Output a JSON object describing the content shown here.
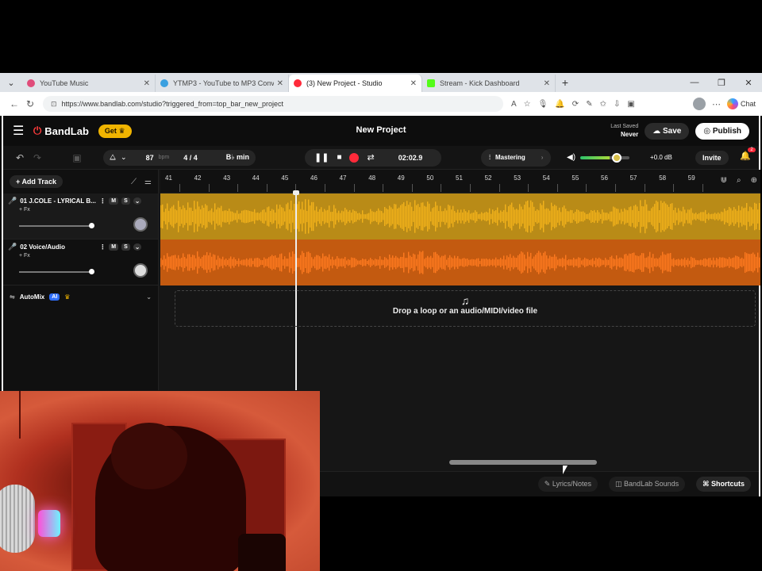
{
  "browser": {
    "tabs": [
      {
        "title": "YouTube Music",
        "favicon_color": "#e04c7a"
      },
      {
        "title": "YTMP3 - YouTube to MP3 Convert",
        "favicon_color": "#3aa0e0"
      },
      {
        "title": "(3) New Project - Studio",
        "favicon_color": "#ff2a3a"
      },
      {
        "title": "Stream - Kick Dashboard",
        "favicon_color": "#53fc18"
      }
    ],
    "url": "https://www.bandlab.com/studio?triggered_from=top_bar_new_project",
    "chat_label": "Chat"
  },
  "app": {
    "brand": "BandLab",
    "get_label": "Get",
    "project_title": "New Project",
    "last_saved_label": "Last Saved",
    "last_saved_value": "Never",
    "save_label": "Save",
    "publish_label": "Publish"
  },
  "toolbar": {
    "bpm_value": "87",
    "bpm_unit": "bpm",
    "time_signature": "4 / 4",
    "key": "B♭ min",
    "time": "02:02.9",
    "mastering_label": "Mastering",
    "volume_db": "+0.0 dB",
    "invite_label": "Invite",
    "notifications": "2"
  },
  "left_panel": {
    "add_track_label": "Add Track",
    "tracks": [
      {
        "name": "01 J.COLE - LYRICAL B...",
        "mute": "M",
        "solo": "S",
        "fx": "+ Fx"
      },
      {
        "name": "02 Voice/Audio",
        "mute": "M",
        "solo": "S",
        "fx": "+ Fx"
      }
    ],
    "automix_label": "AutoMix",
    "automix_badge": "AI"
  },
  "timeline": {
    "bars": [
      "41",
      "42",
      "43",
      "44",
      "45",
      "46",
      "47",
      "48",
      "49",
      "50",
      "51",
      "52",
      "53",
      "54",
      "55",
      "56",
      "57",
      "58",
      "59"
    ]
  },
  "dropzone_text": "Drop a loop or an audio/MIDI/video file",
  "bottom": {
    "lyrics_label": "Lyrics/Notes",
    "sounds_label": "BandLab Sounds",
    "shortcuts_label": "Shortcuts"
  },
  "colors": {
    "track1": "#f2b21a",
    "track2": "#ff7a1f",
    "record": "#ff2a3a",
    "accent": "#f0b400"
  }
}
